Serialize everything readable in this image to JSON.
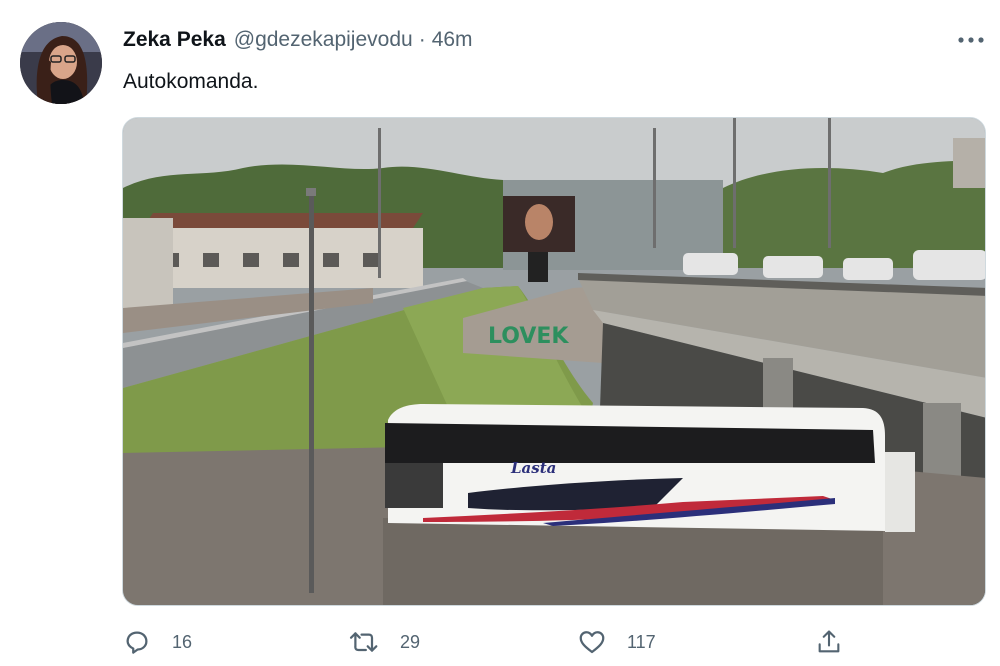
{
  "tweet": {
    "author": {
      "display_name": "Zeka Peka",
      "handle": "@gdezekapijevodu",
      "separator": "·",
      "time": "46m",
      "avatar_icon": "avatar-photo"
    },
    "text": "Autokomanda.",
    "media": {
      "billboard_graffiti": "LOVEK",
      "bus_logo": "Lasta"
    },
    "actions": {
      "reply": {
        "icon": "reply-icon",
        "count": "16"
      },
      "retweet": {
        "icon": "retweet-icon",
        "count": "29"
      },
      "like": {
        "icon": "heart-icon",
        "count": "117"
      },
      "share": {
        "icon": "share-icon"
      }
    },
    "colors": {
      "text": "#0f1419",
      "secondary": "#536471",
      "border": "#cfd9de"
    }
  }
}
